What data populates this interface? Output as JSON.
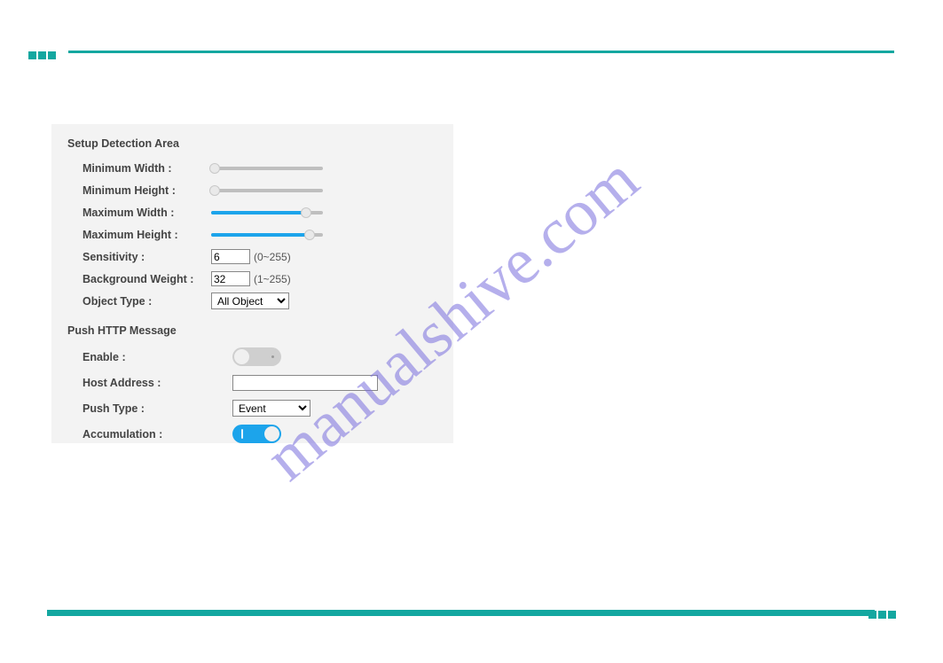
{
  "watermark": "manualshive.com",
  "section1": {
    "title": "Setup Detection Area",
    "min_width": {
      "label": "Minimum Width :",
      "pct": 0
    },
    "min_height": {
      "label": "Minimum Height :",
      "pct": 0
    },
    "max_width": {
      "label": "Maximum Width :",
      "pct": 85
    },
    "max_height": {
      "label": "Maximum Height :",
      "pct": 88
    },
    "sensitivity": {
      "label": "Sensitivity :",
      "value": "6",
      "range": "(0~255)"
    },
    "bg_weight": {
      "label": "Background Weight :",
      "value": "32",
      "range": "(1~255)"
    },
    "object_type": {
      "label": "Object Type :",
      "value": "All Object"
    }
  },
  "section2": {
    "title": "Push HTTP Message",
    "enable": {
      "label": "Enable :",
      "on": false
    },
    "host": {
      "label": "Host Address :",
      "value": ""
    },
    "push_type": {
      "label": "Push Type :",
      "value": "Event"
    },
    "accumulation": {
      "label": "Accumulation :",
      "on": true
    }
  }
}
